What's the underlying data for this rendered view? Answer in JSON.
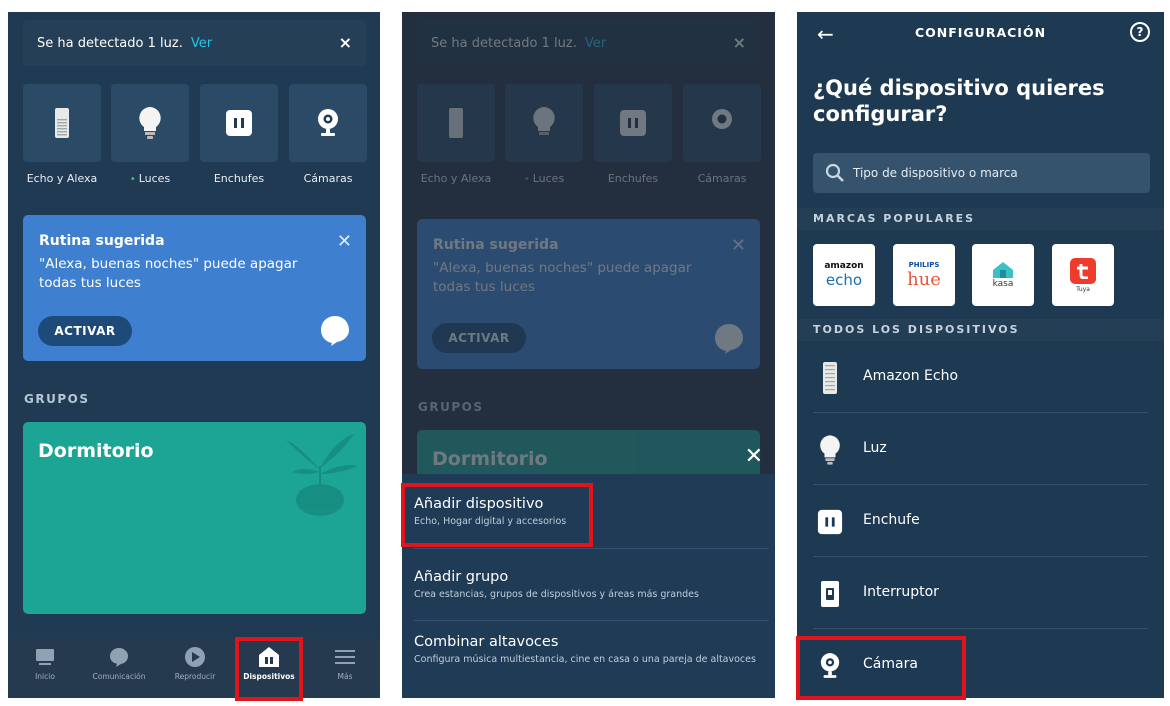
{
  "screen1": {
    "notification": {
      "text": "Se ha detectado 1 luz.",
      "link": "Ver",
      "close": "×"
    },
    "categories": [
      {
        "label": "Echo y Alexa",
        "icon": "echo-device-icon"
      },
      {
        "label": "Luces",
        "icon": "bulb-icon",
        "status_dot": "•"
      },
      {
        "label": "Enchufes",
        "icon": "plug-icon"
      },
      {
        "label": "Cámaras",
        "icon": "camera-icon"
      }
    ],
    "routine_card": {
      "title": "Rutina sugerida",
      "body": "\"Alexa, buenas noches\" puede apagar todas tus luces",
      "button": "ACTIVAR",
      "close": "✕"
    },
    "groups_header": "GRUPOS",
    "group_card": {
      "title": "Dormitorio"
    },
    "tabbar": [
      {
        "label": "Inicio",
        "icon": "home-icon"
      },
      {
        "label": "Comunicación",
        "icon": "chat-bubble-icon"
      },
      {
        "label": "Reproducir",
        "icon": "play-icon"
      },
      {
        "label": "Dispositivos",
        "icon": "devices-house-icon",
        "active": true
      },
      {
        "label": "Más",
        "icon": "menu-icon"
      }
    ]
  },
  "screen2": {
    "sheet_close": "✕",
    "menu": [
      {
        "title": "Añadir dispositivo",
        "subtitle": "Echo, Hogar digital y accesorios"
      },
      {
        "title": "Añadir grupo",
        "subtitle": "Crea estancias, grupos de dispositivos y áreas más grandes"
      },
      {
        "title": "Combinar altavoces",
        "subtitle": "Configura música multiestancia, cine en casa o una pareja de altavoces"
      }
    ]
  },
  "screen3": {
    "header_title": "CONFIGURACIÓN",
    "back": "←",
    "help": "?",
    "question": "¿Qué dispositivo quieres configurar?",
    "search_placeholder": "Tipo de dispositivo o marca",
    "popular_header": "MARCAS POPULARES",
    "brands": [
      {
        "top": "amazon",
        "bottom": "echo"
      },
      {
        "top": "PHILIPS",
        "bottom": "hue"
      },
      {
        "bottom": "kasa"
      },
      {
        "bottom": "Tuya"
      }
    ],
    "all_header": "TODOS LOS DISPOSITIVOS",
    "devices": [
      {
        "label": "Amazon Echo",
        "icon": "echo-device-icon"
      },
      {
        "label": "Luz",
        "icon": "bulb-icon"
      },
      {
        "label": "Enchufe",
        "icon": "plug-icon"
      },
      {
        "label": "Interruptor",
        "icon": "switch-icon"
      },
      {
        "label": "Cámara",
        "icon": "camera-icon"
      }
    ]
  },
  "colors": {
    "highlight": "#e0141b",
    "accent": "#25c7e8",
    "routine": "#3f7fcf",
    "group": "#1ca494"
  }
}
